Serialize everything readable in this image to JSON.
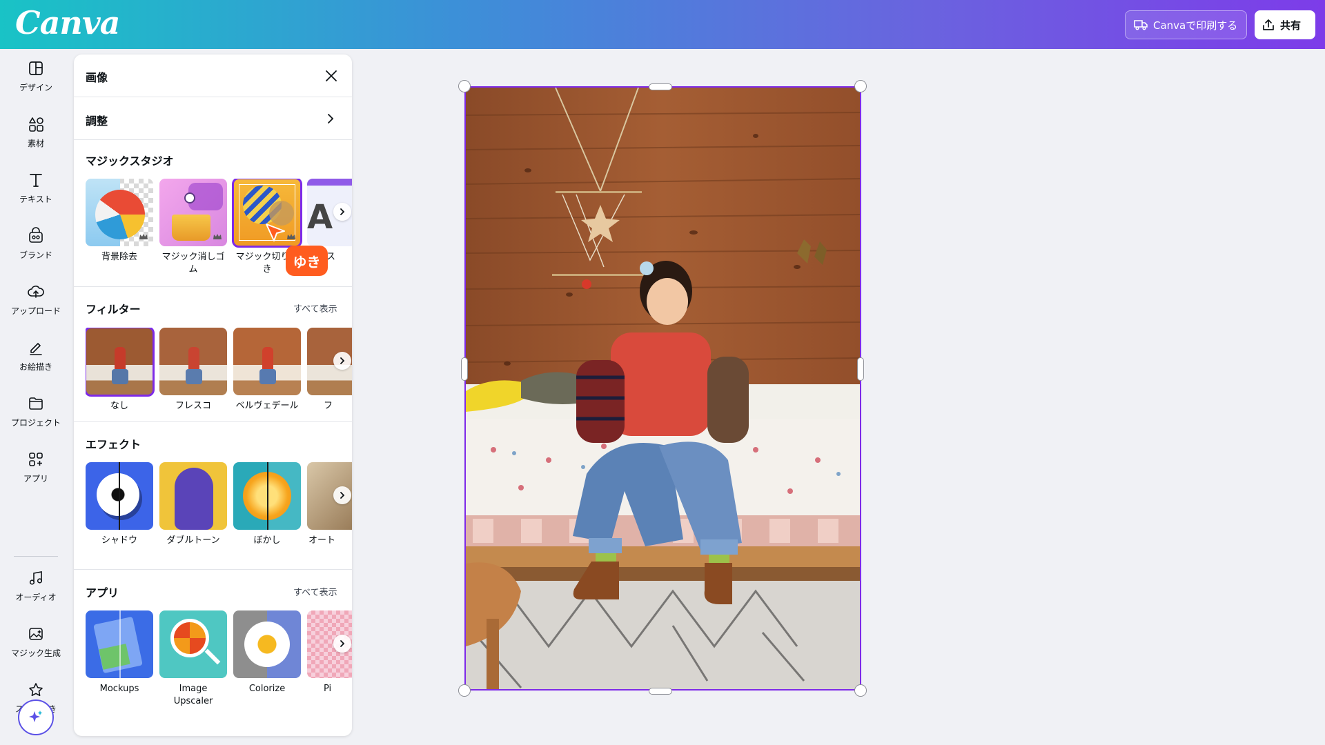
{
  "app": {
    "logo": "Canva"
  },
  "header": {
    "print_label": "Canvaで印刷する",
    "share_label": "共有"
  },
  "rail": {
    "items": [
      {
        "label": "デザイン",
        "icon": "layout-icon"
      },
      {
        "label": "素材",
        "icon": "shapes-icon"
      },
      {
        "label": "テキスト",
        "icon": "text-icon"
      },
      {
        "label": "ブランド",
        "icon": "brand-icon"
      },
      {
        "label": "アップロード",
        "icon": "cloud-upload-icon"
      },
      {
        "label": "お絵描き",
        "icon": "pen-icon"
      },
      {
        "label": "プロジェクト",
        "icon": "folder-icon"
      },
      {
        "label": "アプリ",
        "icon": "apps-icon"
      },
      {
        "label": "オーディオ",
        "icon": "music-icon"
      },
      {
        "label": "マジック生成",
        "icon": "magic-image-icon"
      },
      {
        "label": "スター付き",
        "icon": "star-icon"
      }
    ]
  },
  "panel": {
    "title": "画像",
    "adjust_label": "調整",
    "magic_studio": {
      "title": "マジックスタジオ",
      "tiles": [
        {
          "label": "背景除去"
        },
        {
          "label": "マジック消しゴム"
        },
        {
          "label": "マジック切り抜き"
        },
        {
          "label": "ス"
        }
      ]
    },
    "filters": {
      "title": "フィルター",
      "see_all": "すべて表示",
      "tiles": [
        {
          "label": "なし"
        },
        {
          "label": "フレスコ"
        },
        {
          "label": "ベルヴェデール"
        },
        {
          "label": "フ"
        }
      ]
    },
    "effects": {
      "title": "エフェクト",
      "tiles": [
        {
          "label": "シャドウ"
        },
        {
          "label": "ダブルトーン"
        },
        {
          "label": "ぼかし"
        },
        {
          "label": "オート"
        }
      ]
    },
    "apps": {
      "title": "アプリ",
      "see_all": "すべて表示",
      "tiles": [
        {
          "label": "Mockups"
        },
        {
          "label": "Image Upscaler"
        },
        {
          "label": "Colorize"
        },
        {
          "label": "Pi"
        }
      ]
    }
  },
  "collaborator": {
    "name": "ゆき",
    "color": "#ff5c1f"
  },
  "colors": {
    "accent": "#7d2ae8",
    "selection": "#7d2ae8"
  }
}
